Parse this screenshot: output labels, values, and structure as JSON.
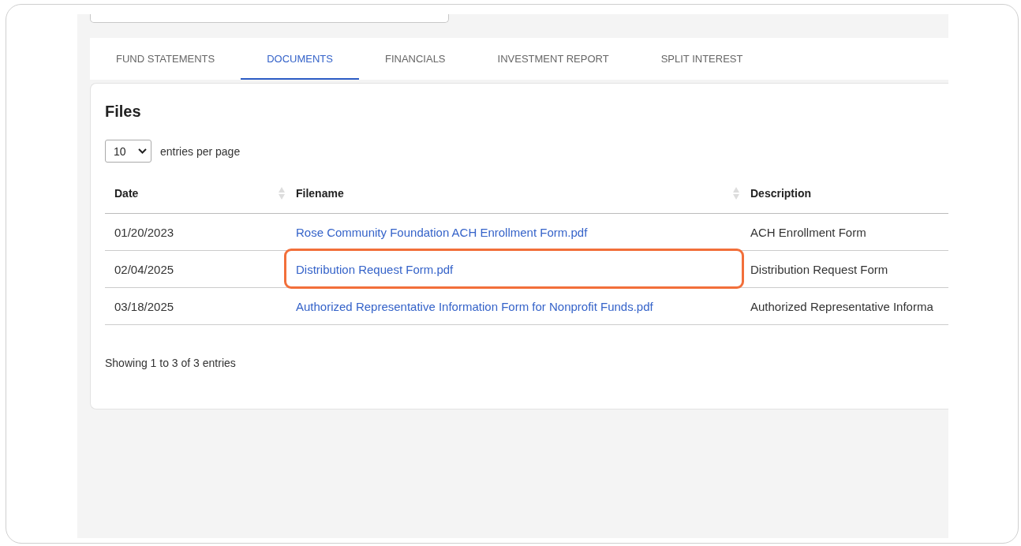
{
  "tabs": [
    {
      "label": "FUND STATEMENTS",
      "selected": false
    },
    {
      "label": "DOCUMENTS",
      "selected": true
    },
    {
      "label": "FINANCIALS",
      "selected": false
    },
    {
      "label": "INVESTMENT REPORT",
      "selected": false
    },
    {
      "label": "SPLIT INTEREST",
      "selected": false
    }
  ],
  "card": {
    "title": "Files",
    "page_size": {
      "value": "10",
      "label": "entries per page"
    },
    "table": {
      "columns": [
        {
          "label": "Date",
          "sortable": true
        },
        {
          "label": "Filename",
          "sortable": true
        },
        {
          "label": "Description",
          "sortable": false
        }
      ],
      "rows": [
        {
          "date": "01/20/2023",
          "filename": "Rose Community Foundation ACH Enrollment Form.pdf",
          "description": "ACH Enrollment Form",
          "highlighted": false
        },
        {
          "date": "02/04/2025",
          "filename": "Distribution Request Form.pdf",
          "description": "Distribution Request Form",
          "highlighted": true
        },
        {
          "date": "03/18/2025",
          "filename": "Authorized Representative Information Form for Nonprofit Funds.pdf",
          "description": "Authorized Representative Informa",
          "highlighted": false
        }
      ]
    },
    "footer": "Showing 1 to 3 of 3 entries"
  }
}
